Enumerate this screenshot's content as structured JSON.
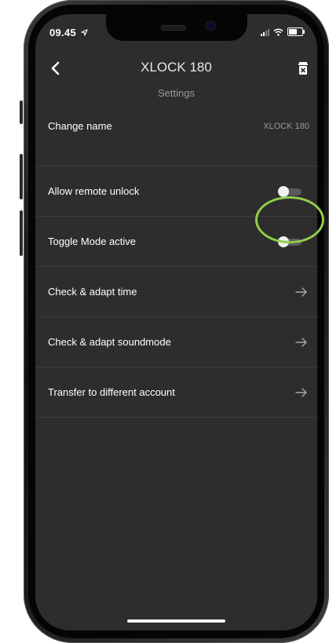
{
  "status_bar": {
    "time": "09.45"
  },
  "header": {
    "title": "XLOCK 180",
    "subtitle": "Settings"
  },
  "rows": [
    {
      "label": "Change name",
      "value": "XLOCK 180"
    },
    {
      "label": "Allow remote unlock",
      "toggle_on": false
    },
    {
      "label": "Toggle Mode active",
      "toggle_on": false
    },
    {
      "label": "Check & adapt time"
    },
    {
      "label": "Check & adapt soundmode"
    },
    {
      "label": "Transfer to different account"
    }
  ],
  "icons": {
    "back": "chevron-left-icon",
    "delete": "trash-icon",
    "arrow": "arrow-right-icon",
    "location": "location-arrow-icon",
    "signal": "signal-icon",
    "wifi": "wifi-icon",
    "battery": "battery-icon"
  },
  "colors": {
    "screen_background": "#2d2d2d",
    "divider": "#3d3d3d",
    "toggle_track": "#5a5a5a",
    "toggle_knob": "#f0f0f0",
    "highlight": "#8fcf4a"
  }
}
